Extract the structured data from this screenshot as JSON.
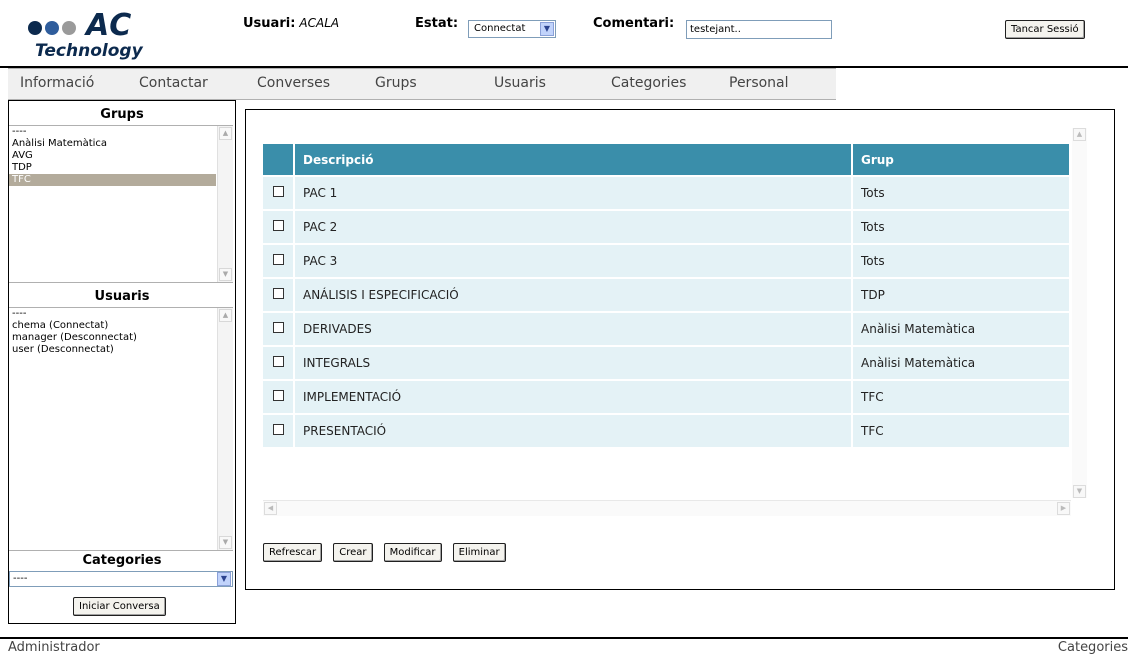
{
  "header": {
    "logo_ac": "AC",
    "logo_technology": "Technology",
    "user_label": "Usuari:",
    "user_value": "ACALA",
    "status_label": "Estat:",
    "status_value": "Connectat",
    "comment_label": "Comentari:",
    "comment_value": "testejant..",
    "logout_label": "Tancar Sessió",
    "logo_colors": [
      "#0c2a4e",
      "#2f5d9c",
      "#9a9a9a"
    ]
  },
  "nav": {
    "items": [
      "Informació",
      "Contactar",
      "Converses",
      "Grups",
      "Usuaris",
      "Categories",
      "Personal"
    ]
  },
  "sidebar": {
    "groups_title": "Grups",
    "groups": [
      "----",
      "Anàlisi Matemàtica",
      "AVG",
      "TDP",
      "TFC"
    ],
    "groups_selected": "TFC",
    "users_title": "Usuaris",
    "users": [
      "----",
      "chema (Connectat)",
      "manager (Desconnectat)",
      "user (Desconnectat)"
    ],
    "categories_title": "Categories",
    "categories_value": "----",
    "start_button": "Iniciar Conversa"
  },
  "main": {
    "columns": [
      "Descripció",
      "Grup"
    ],
    "rows": [
      {
        "descripcio": "PAC 1",
        "grup": "Tots"
      },
      {
        "descripcio": "PAC 2",
        "grup": "Tots"
      },
      {
        "descripcio": "PAC 3",
        "grup": "Tots"
      },
      {
        "descripcio": "ANÁLISIS I ESPECIFICACIÓ",
        "grup": "TDP"
      },
      {
        "descripcio": "DERIVADES",
        "grup": "Anàlisi Matemàtica"
      },
      {
        "descripcio": "INTEGRALS",
        "grup": "Anàlisi Matemàtica"
      },
      {
        "descripcio": "IMPLEMENTACIÓ",
        "grup": "TFC"
      },
      {
        "descripcio": "PRESENTACIÓ",
        "grup": "TFC"
      }
    ],
    "buttons": {
      "refresh": "Refrescar",
      "create": "Crear",
      "modify": "Modificar",
      "delete": "Eliminar"
    }
  },
  "footer": {
    "left": "Administrador",
    "right": "Categories"
  },
  "colors": {
    "grid_header": "#3a8eaa",
    "grid_row": "#e4f2f6",
    "selected_item": "#b3ab9b"
  }
}
